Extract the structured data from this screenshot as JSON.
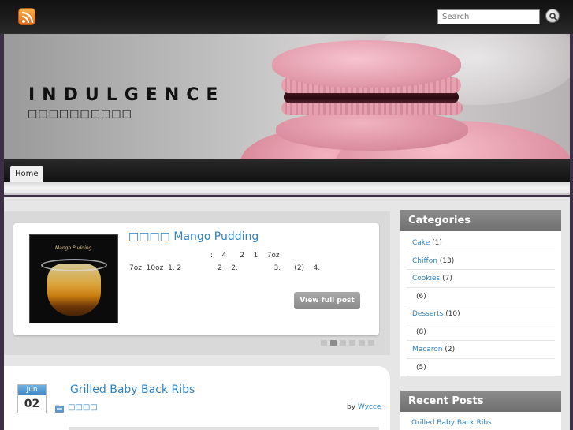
{
  "header": {
    "search_placeholder": "Search",
    "title": "INDULGENCE",
    "description": "□□□□□□□□□□"
  },
  "nav": {
    "items": [
      {
        "label": "Home"
      }
    ]
  },
  "featured": {
    "title": "□□□□ Mango Pudding",
    "image_caption": "Mango Pudding",
    "excerpt_line1": "                                    :    4      2    1    7oz",
    "excerpt_line2": "7oz  10oz  1. 2                2    2.                3.      (2)    4.",
    "view_button": "View full post",
    "dots": 6,
    "active_dot": 1
  },
  "post": {
    "month": "Jun",
    "day": "02",
    "title": "Grilled Baby Back Ribs",
    "category": "□□□□",
    "by_label": "by",
    "author": "Wycce"
  },
  "sidebar": {
    "categories_title": "Categories",
    "categories": [
      {
        "name": "Cake",
        "count": "(1)"
      },
      {
        "name": "Chiffon",
        "count": "(13)"
      },
      {
        "name": "Cookies",
        "count": "(7)"
      },
      {
        "name": "",
        "count": "(6)"
      },
      {
        "name": "Desserts",
        "count": "(10)"
      },
      {
        "name": "",
        "count": "(8)"
      },
      {
        "name": "Macaron",
        "count": "(2)"
      },
      {
        "name": "",
        "count": "(5)"
      }
    ],
    "recent_title": "Recent Posts",
    "recent": [
      {
        "title": "Grilled Baby Back Ribs"
      }
    ]
  },
  "colors": {
    "link": "#2f82c4",
    "widget_header": "#7d7d7d",
    "page_bg": "#3a2f45"
  }
}
